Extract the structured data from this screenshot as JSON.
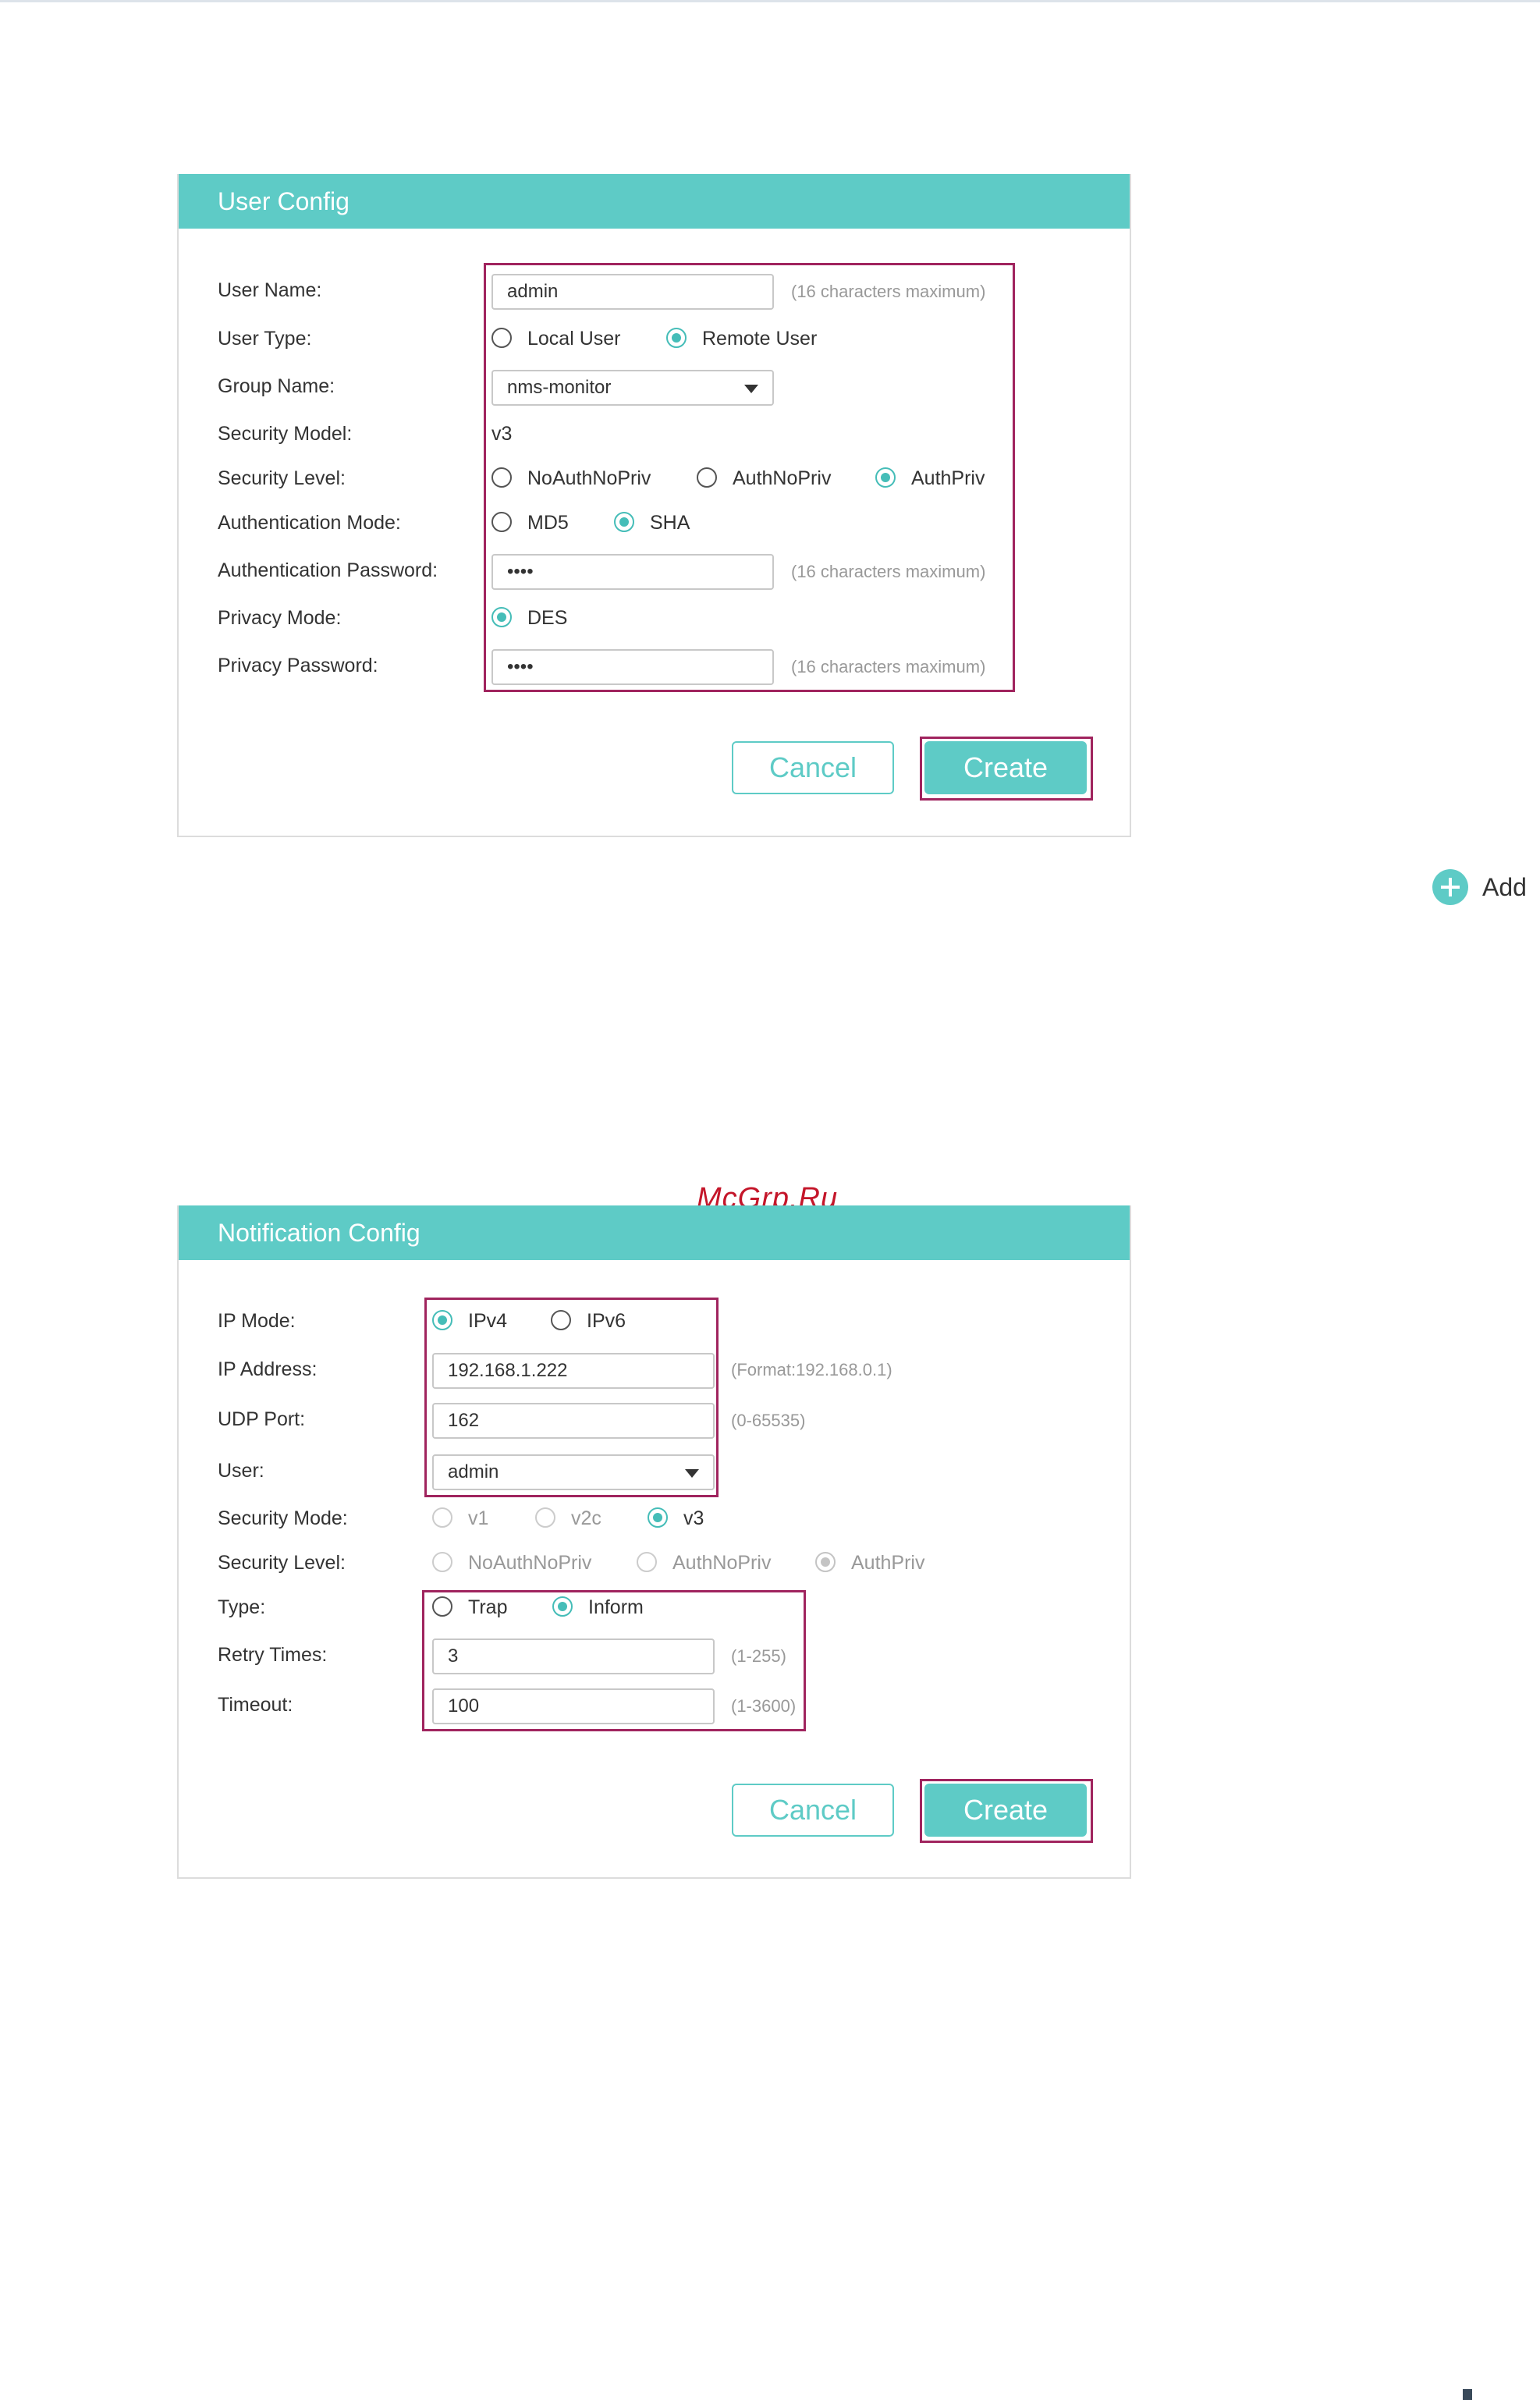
{
  "user_config": {
    "title": "User Config",
    "user_name_label": "User Name:",
    "user_name_value": "admin",
    "user_name_hint": "(16 characters maximum)",
    "user_type_label": "User Type:",
    "user_type_options": [
      "Local User",
      "Remote User"
    ],
    "user_type_selected": "Remote User",
    "group_name_label": "Group Name:",
    "group_name_value": "nms-monitor",
    "security_model_label": "Security Model:",
    "security_model_value": "v3",
    "security_level_label": "Security Level:",
    "security_level_options": [
      "NoAuthNoPriv",
      "AuthNoPriv",
      "AuthPriv"
    ],
    "security_level_selected": "AuthPriv",
    "auth_mode_label": "Authentication Mode:",
    "auth_mode_options": [
      "MD5",
      "SHA"
    ],
    "auth_mode_selected": "SHA",
    "auth_password_label": "Authentication Password:",
    "auth_password_value": "••••",
    "auth_password_hint": "(16 characters maximum)",
    "privacy_mode_label": "Privacy Mode:",
    "privacy_mode_options": [
      "DES"
    ],
    "privacy_mode_selected": "DES",
    "privacy_password_label": "Privacy Password:",
    "privacy_password_value": "••••",
    "privacy_password_hint": "(16 characters maximum)",
    "cancel_label": "Cancel",
    "create_label": "Create"
  },
  "add_button": {
    "label": "Add"
  },
  "watermark": "McGrp.Ru",
  "notification_config": {
    "title": "Notification Config",
    "ip_mode_label": "IP Mode:",
    "ip_mode_options": [
      "IPv4",
      "IPv6"
    ],
    "ip_mode_selected": "IPv4",
    "ip_address_label": "IP Address:",
    "ip_address_value": "192.168.1.222",
    "ip_address_hint": "(Format:192.168.0.1)",
    "udp_port_label": "UDP Port:",
    "udp_port_value": "162",
    "udp_port_hint": "(0-65535)",
    "user_label": "User:",
    "user_value": "admin",
    "security_mode_label": "Security Mode:",
    "security_mode_options": [
      "v1",
      "v2c",
      "v3"
    ],
    "security_mode_selected": "v3",
    "security_level_label": "Security Level:",
    "security_level_options": [
      "NoAuthNoPriv",
      "AuthNoPriv",
      "AuthPriv"
    ],
    "security_level_selected": "AuthPriv",
    "type_label": "Type:",
    "type_options": [
      "Trap",
      "Inform"
    ],
    "type_selected": "Inform",
    "retry_times_label": "Retry Times:",
    "retry_times_value": "3",
    "retry_times_hint": "(1-255)",
    "timeout_label": "Timeout:",
    "timeout_value": "100",
    "timeout_hint": "(1-3600)",
    "cancel_label": "Cancel",
    "create_label": "Create"
  },
  "colors": {
    "accent": "#5ecbc6",
    "highlight": "#a0245e",
    "watermark": "#c4162a"
  }
}
